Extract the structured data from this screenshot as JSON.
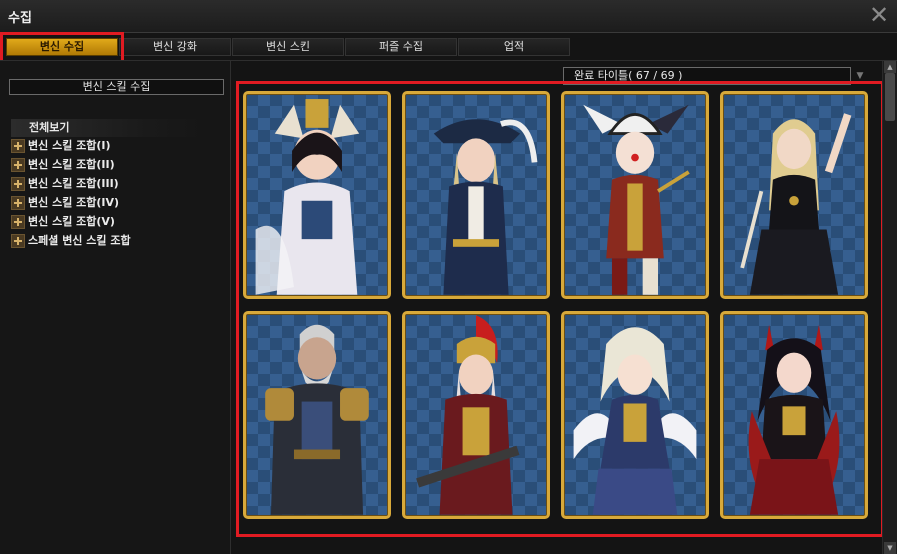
{
  "window": {
    "title": "수집",
    "close_icon": "close-icon"
  },
  "tabs": [
    {
      "label": "변신 수집",
      "active": true
    },
    {
      "label": "변신 강화",
      "active": false
    },
    {
      "label": "변신 스킨",
      "active": false
    },
    {
      "label": "퍼즐 수집",
      "active": false
    },
    {
      "label": "업적",
      "active": false
    }
  ],
  "left_panel": {
    "header": "변신 스킬 수집",
    "all_view": "전체보기",
    "items": [
      "변신 스킬 조합(I)",
      "변신 스킬 조합(II)",
      "변신 스킬 조합(III)",
      "변신 스킬 조합(IV)",
      "변신 스킬 조합(V)",
      "스페셜 변신 스킬 조합"
    ]
  },
  "right_panel": {
    "dropdown": "완료 타이틀( 67 / 69 )",
    "dropdown_icon": "triangle-down-icon",
    "cards": [
      {
        "icon": "character-card-fox-girl"
      },
      {
        "icon": "character-card-musketeer"
      },
      {
        "icon": "character-card-jester"
      },
      {
        "icon": "character-card-dancer"
      },
      {
        "icon": "character-card-warrior"
      },
      {
        "icon": "character-card-valkyrie"
      },
      {
        "icon": "character-card-angel"
      },
      {
        "icon": "character-card-vampire"
      }
    ]
  },
  "colors": {
    "accent_gold": "#d8a93a",
    "active_tab": "#e0a91a",
    "highlight_red": "#e01b22",
    "card_bg": "#2a4e78"
  }
}
